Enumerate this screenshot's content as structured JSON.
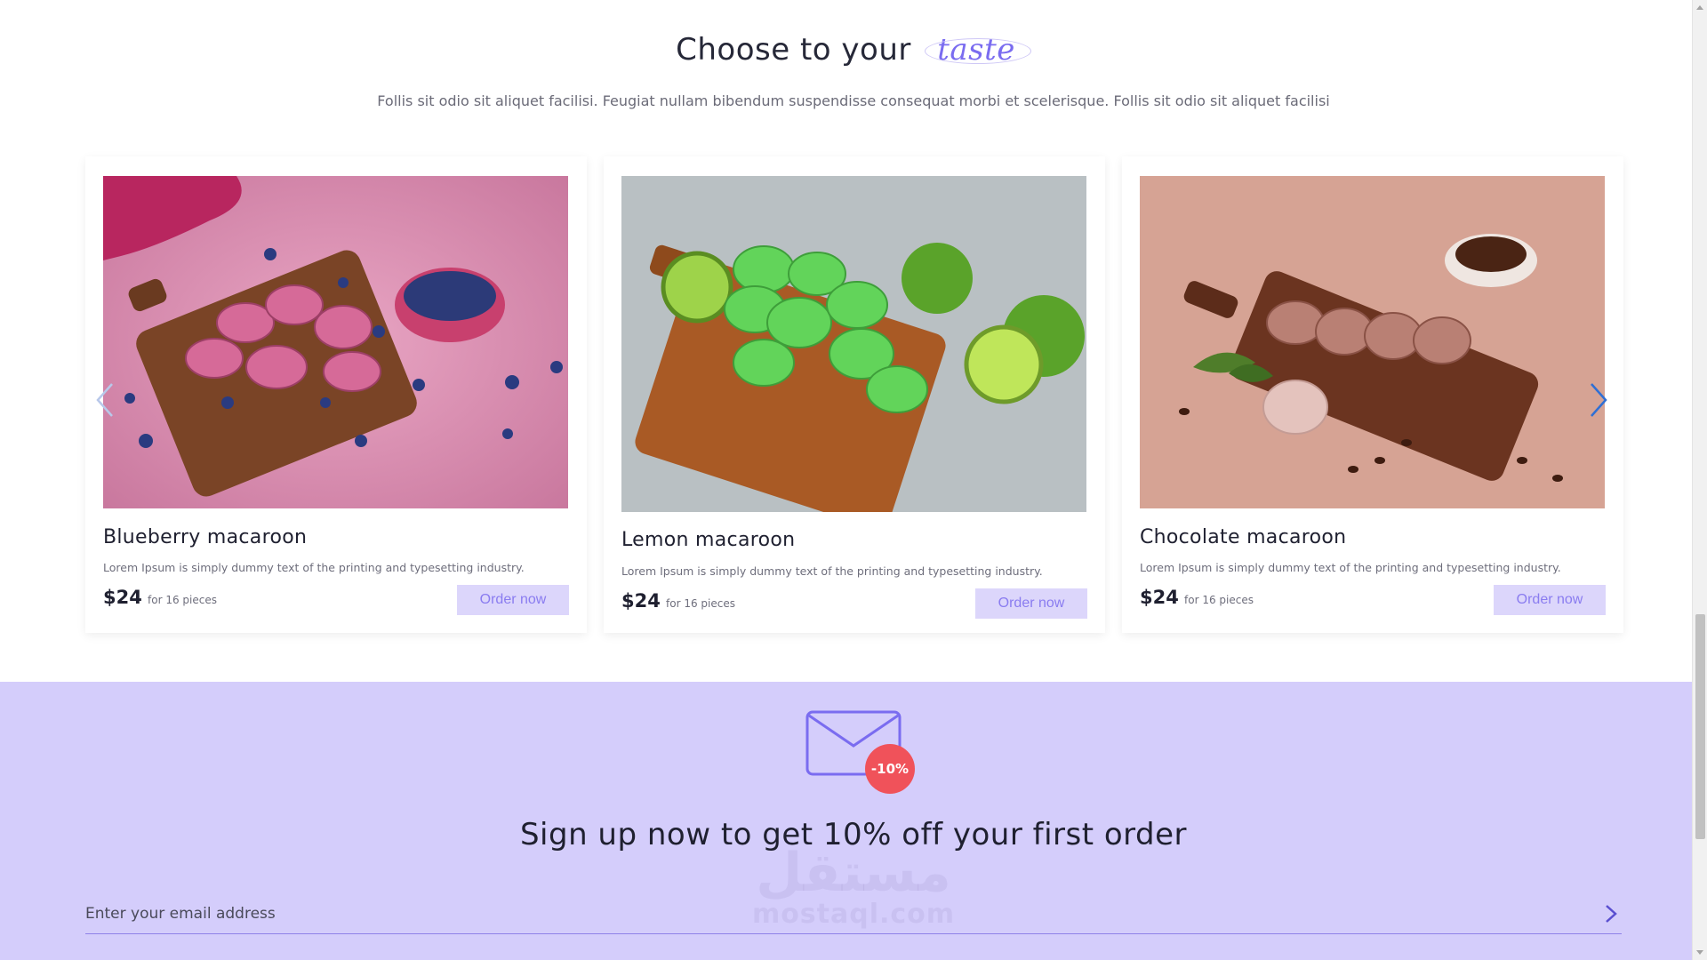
{
  "section": {
    "title_prefix": "Choose to your",
    "title_accent": "taste",
    "subtitle": "Follis sit odio sit aliquet facilisi. Feugiat nullam bibendum suspendisse consequat morbi et scelerisque. Follis sit odio sit aliquet facilisi"
  },
  "products": [
    {
      "name": "Blueberry macaroon",
      "description": "Lorem Ipsum is simply dummy text of the printing and typesetting industry.",
      "price": "$24",
      "pieces": "for 16 pieces",
      "order_label": "Order now",
      "image_icon": "blueberry-macaroons-photo"
    },
    {
      "name": "Lemon macaroon",
      "description": "Lorem Ipsum is simply dummy text of the printing and typesetting industry.",
      "price": "$24",
      "pieces": "for 16 pieces",
      "order_label": "Order now",
      "image_icon": "lime-macaroons-photo"
    },
    {
      "name": "Chocolate macaroon",
      "description": "Lorem Ipsum is simply dummy text of the printing and typesetting industry.",
      "price": "$24",
      "pieces": "for 16 pieces",
      "order_label": "Order now",
      "image_icon": "chocolate-macaroons-photo"
    }
  ],
  "carousel": {
    "prev_icon": "chevron-left-icon",
    "next_icon": "chevron-right-icon"
  },
  "signup": {
    "badge": "-10%",
    "title": "Sign up now to get 10% off your first order",
    "email_placeholder": "Enter your email address",
    "email_value": "",
    "submit_icon": "chevron-right-icon"
  },
  "watermark": {
    "arabic": "مستقل",
    "latin": "mostaql.com"
  },
  "colors": {
    "accent": "#7a6cf0",
    "button_bg": "#dcd6fb",
    "band_bg": "#d4cdfb",
    "badge": "#f0525a"
  }
}
